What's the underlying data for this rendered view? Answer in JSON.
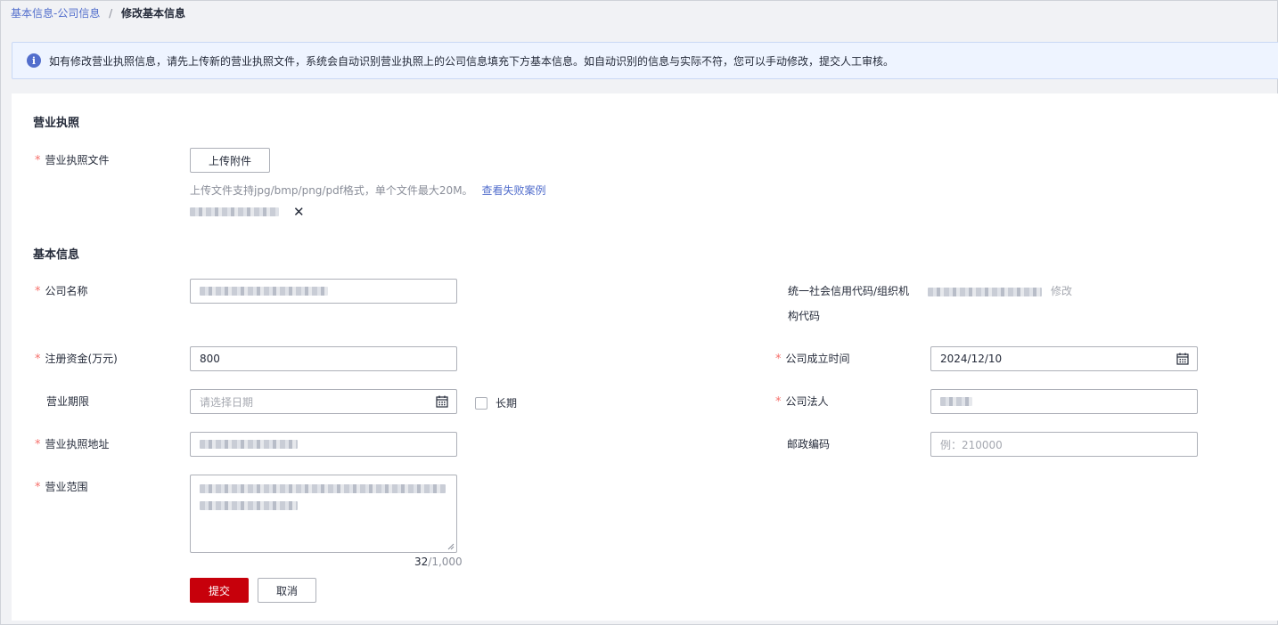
{
  "breadcrumb": {
    "parent": "基本信息-公司信息",
    "separator": "/",
    "current": "修改基本信息"
  },
  "notice": {
    "icon": "info-icon",
    "icon_glyph": "i",
    "text": "如有修改营业执照信息，请先上传新的营业执照文件，系统会自动识别营业执照上的公司信息填充下方基本信息。如自动识别的信息与实际不符，您可以手动修改，提交人工审核。"
  },
  "license_section": {
    "title": "营业执照",
    "file_label": "营业执照文件",
    "upload_button": "上传附件",
    "hint": "上传文件支持jpg/bmp/png/pdf格式，单个文件最大20M。",
    "fail_link": "查看失败案例",
    "remove_glyph": "✕"
  },
  "basic_section": {
    "title": "基本信息",
    "required_mark": "*",
    "company_name": {
      "label": "公司名称"
    },
    "credit_code": {
      "label_line1": "统一社会信用代码/组织机",
      "label_line2": "构代码",
      "edit_link": "修改"
    },
    "registered_capital": {
      "label": "注册资金(万元)",
      "value": "800"
    },
    "established_date": {
      "label": "公司成立时间",
      "value": "2024/12/10"
    },
    "business_term": {
      "label": "营业期限",
      "placeholder": "请选择日期",
      "long_term_label": "长期"
    },
    "legal_person": {
      "label": "公司法人"
    },
    "license_address": {
      "label": "营业执照地址"
    },
    "postal_code": {
      "label": "邮政编码",
      "placeholder": "例：210000"
    },
    "business_scope": {
      "label": "营业范围",
      "count": "32",
      "max": "/1,000"
    }
  },
  "actions": {
    "submit": "提交",
    "cancel": "取消"
  },
  "colors": {
    "primary": "#c7000b",
    "link": "#526ecc",
    "required": "#f66f6a"
  }
}
